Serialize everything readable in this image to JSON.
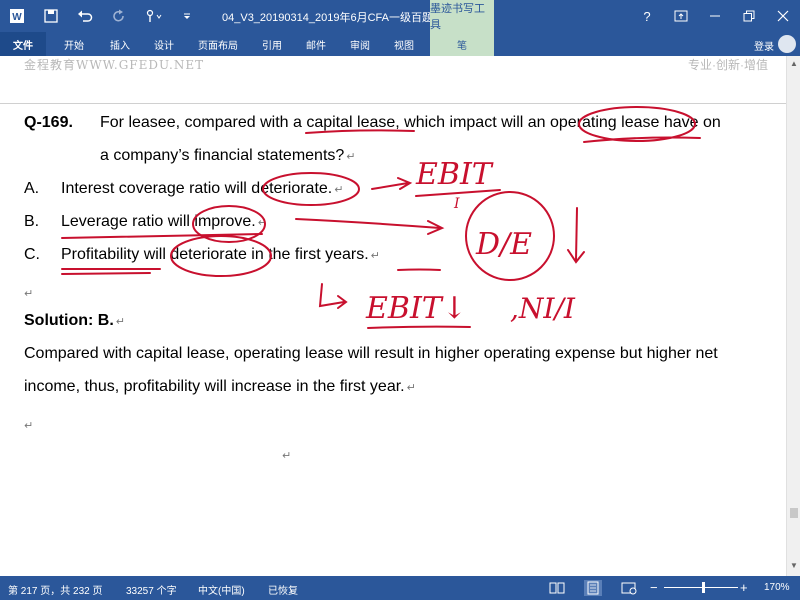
{
  "titlebar": {
    "doc_title": "04_V3_20190314_2019年6月CFA一级百题预...",
    "contextual_tab": "墨迹书写工具",
    "help": "?",
    "colors": {
      "brand": "#2b579a",
      "contextual": "#c7e0c8"
    }
  },
  "ribbon": {
    "tabs": [
      "文件",
      "开始",
      "插入",
      "设计",
      "页面布局",
      "引用",
      "邮件",
      "审阅",
      "视图",
      "笔"
    ],
    "login": "登录"
  },
  "document": {
    "header_left": "金程教育WWW.GFEDU.NET",
    "header_right": "专业·创新·增值",
    "question_label": "Q-169.",
    "question_line1": "For leasee, compared with a capital lease, which impact will an operating lease have on",
    "question_line2": "a company’s financial statements?",
    "options": [
      {
        "letter": "A.",
        "text": "Interest coverage ratio will deteriorate."
      },
      {
        "letter": "B.",
        "text": "Leverage ratio will improve."
      },
      {
        "letter": "C.",
        "text": "Profitability will deteriorate in the first years."
      }
    ],
    "solution_label": "Solution: B.",
    "solution_line1": "Compared with capital lease, operating lease will result in higher operating expense but higher net",
    "solution_line2": "income, thus, profitability will increase in the first year."
  },
  "annotations": {
    "ink_color": "#c8102e",
    "ebit": "EBIT",
    "ebit_denominator": "I",
    "de_ratio": "D/E",
    "ebit_down": "EBIT↓",
    "ni_fraction": ",NI/I"
  },
  "statusbar": {
    "page": "第 217 页，共 232 页",
    "words": "33257 个字",
    "language": "中文(中国)",
    "state": "已恢复",
    "zoom_minus": "−",
    "zoom_plus": "+",
    "zoom": "170%",
    "zoom_level_percent": 170
  }
}
